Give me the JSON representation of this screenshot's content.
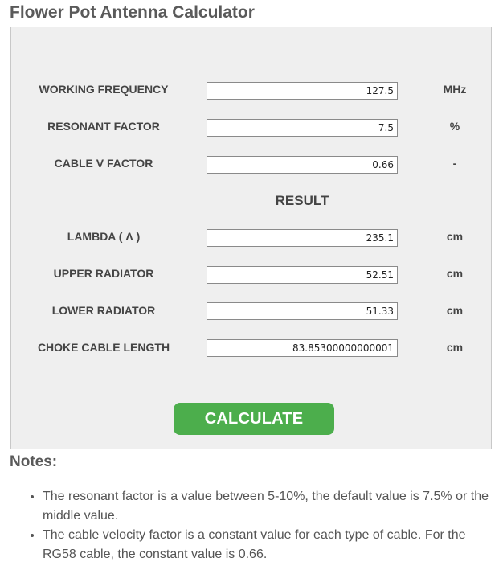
{
  "page": {
    "title": "Flower Pot Antenna Calculator"
  },
  "inputs": [
    {
      "label": "WORKING FREQUENCY",
      "value": "127.5",
      "unit": "MHz"
    },
    {
      "label": "RESONANT FACTOR",
      "value": "7.5",
      "unit": "%"
    },
    {
      "label": "CABLE V FACTOR",
      "value": "0.66",
      "unit": "-"
    }
  ],
  "result_heading": "RESULT",
  "results": [
    {
      "label": "LAMBDA ( Λ )",
      "value": "235.1",
      "unit": "cm"
    },
    {
      "label": "UPPER RADIATOR",
      "value": "52.51",
      "unit": "cm"
    },
    {
      "label": "LOWER RADIATOR",
      "value": "51.33",
      "unit": "cm"
    },
    {
      "label": "CHOKE CABLE LENGTH",
      "value": "83.85300000000001",
      "unit": "cm"
    }
  ],
  "calculate_label": "CALCULATE",
  "notes": {
    "title": "Notes:",
    "items": [
      "The resonant factor is a value between 5-10%, the default value is 7.5% or the middle value.",
      "The cable velocity factor is a constant value for each type of cable. For the RG58 cable, the constant value is 0.66."
    ]
  },
  "colors": {
    "button": "#4cae4c",
    "panel": "#efefef",
    "text": "#555555"
  }
}
